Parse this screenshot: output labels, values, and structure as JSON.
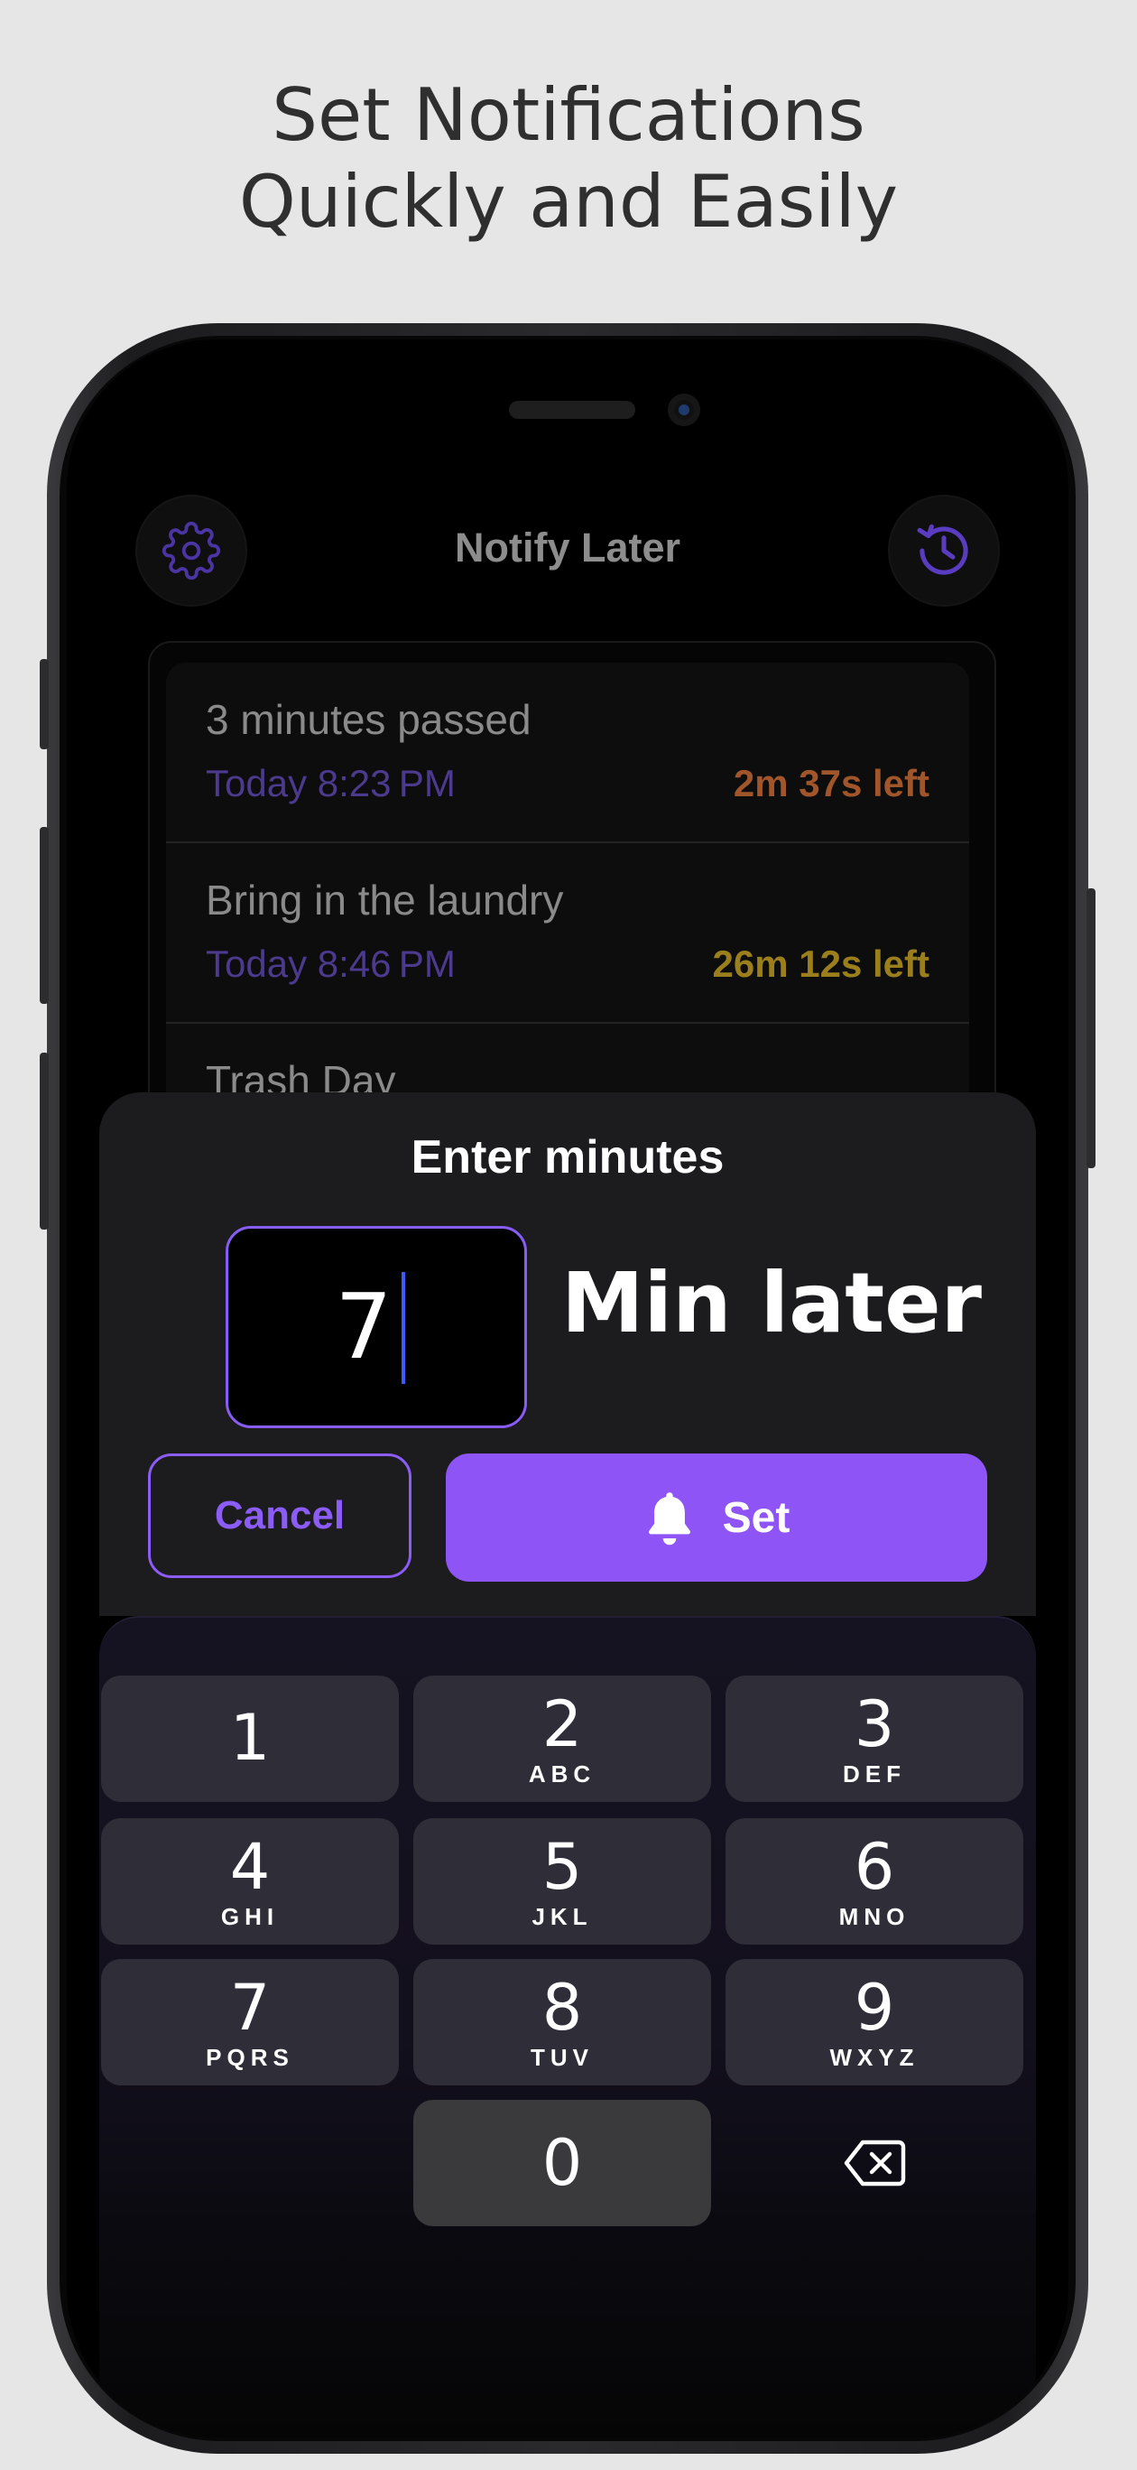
{
  "headline": {
    "line1": "Set Notifications",
    "line2": "Quickly and Easily"
  },
  "app": {
    "title": "Notify Later",
    "settings_icon": "gear-icon",
    "history_icon": "history-clock-icon",
    "accent_color": "#8b5cf6"
  },
  "notifications": [
    {
      "title": "3 minutes passed",
      "time": "Today 8:23 PM",
      "remaining": "2m 37s left",
      "remaining_color": "#a0562a"
    },
    {
      "title": "Bring in the laundry",
      "time": "Today 8:46 PM",
      "remaining": "26m 12s left",
      "remaining_color": "#9a7f1c"
    },
    {
      "title": "Trash Day"
    }
  ],
  "dialog": {
    "title": "Enter minutes",
    "minutes_value": "7",
    "suffix": "Min later",
    "cancel_label": "Cancel",
    "set_label": "Set",
    "set_icon": "bell-icon"
  },
  "keypad": {
    "keys": [
      {
        "num": "1",
        "letters": ""
      },
      {
        "num": "2",
        "letters": "ABC"
      },
      {
        "num": "3",
        "letters": "DEF"
      },
      {
        "num": "4",
        "letters": "GHI"
      },
      {
        "num": "5",
        "letters": "JKL"
      },
      {
        "num": "6",
        "letters": "MNO"
      },
      {
        "num": "7",
        "letters": "PQRS"
      },
      {
        "num": "8",
        "letters": "TUV"
      },
      {
        "num": "9",
        "letters": "WXYZ"
      },
      {
        "num": "0",
        "letters": ""
      }
    ],
    "delete_icon": "backspace-icon"
  }
}
